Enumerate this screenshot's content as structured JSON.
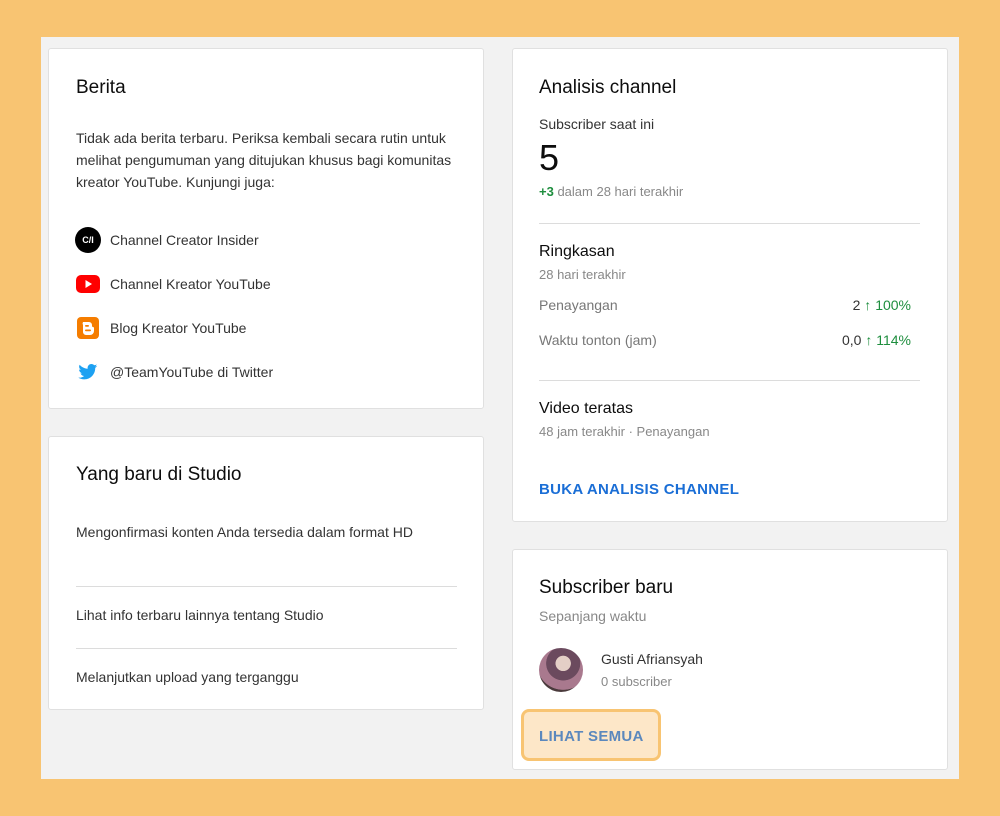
{
  "news": {
    "title": "Berita",
    "body": "Tidak ada berita terbaru. Periksa kembali secara rutin untuk melihat pengumuman yang ditujukan khusus bagi komunitas kreator YouTube. Kunjungi juga:",
    "links": [
      {
        "label": "Channel Creator Insider",
        "icon": "creator-insider-icon",
        "icon_text": "C/I"
      },
      {
        "label": "Channel Kreator YouTube",
        "icon": "youtube-icon"
      },
      {
        "label": "Blog Kreator YouTube",
        "icon": "blogger-icon"
      },
      {
        "label": "@TeamYouTube di Twitter",
        "icon": "twitter-icon"
      }
    ]
  },
  "studio": {
    "title": "Yang baru di Studio",
    "items": [
      "Mengonfirmasi konten Anda tersedia dalam format HD",
      "Lihat info terbaru lainnya tentang Studio",
      "Melanjutkan upload yang terganggu"
    ]
  },
  "analytics": {
    "title": "Analisis channel",
    "subscriber_label": "Subscriber saat ini",
    "subscriber_count": "5",
    "change_value": "+3",
    "change_label": "dalam 28 hari terakhir",
    "summary_title": "Ringkasan",
    "summary_period": "28 hari terakhir",
    "stats": [
      {
        "label": "Penayangan",
        "value": "2",
        "change": "100%"
      },
      {
        "label": "Waktu tonton (jam)",
        "value": "0,0",
        "change": "114%"
      }
    ],
    "top_videos_title": "Video teratas",
    "top_videos_sub": "48 jam terakhir · Penayangan",
    "open_button": "BUKA ANALISIS CHANNEL"
  },
  "new_subscribers": {
    "title": "Subscriber baru",
    "period": "Sepanjang waktu",
    "subscriber": {
      "name": "Gusti Afriansyah",
      "count": "0 subscriber"
    },
    "see_all": "LIHAT SEMUA"
  },
  "colors": {
    "background": "#f8c472",
    "accent_link": "#1a6ed6",
    "positive": "#1e8e3e",
    "highlight": "#f8c472"
  }
}
